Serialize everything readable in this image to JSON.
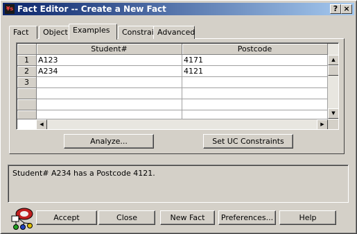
{
  "window": {
    "title": "Fact Editor -- Create a New Fact",
    "icon_label": "¥s",
    "help_label": "?",
    "close_label": "×"
  },
  "tabs": [
    {
      "label": "Fact",
      "active": false
    },
    {
      "label": "Object",
      "active": false
    },
    {
      "label": "Examples",
      "active": true
    },
    {
      "label": "Constraints",
      "active": false
    },
    {
      "label": "Advanced",
      "active": false
    }
  ],
  "grid": {
    "columns": [
      "Student#",
      "Postcode"
    ],
    "rows": [
      {
        "num": "1",
        "cells": [
          "A123",
          "4171"
        ]
      },
      {
        "num": "2",
        "cells": [
          "A234",
          "4121"
        ]
      },
      {
        "num": "3",
        "cells": [
          "",
          ""
        ]
      },
      {
        "num": "",
        "cells": [
          "",
          ""
        ]
      },
      {
        "num": "",
        "cells": [
          "",
          ""
        ]
      }
    ],
    "scroll_icons": {
      "up": "triangle-up",
      "down": "triangle-down",
      "left": "triangle-left",
      "right": "triangle-right"
    }
  },
  "actions": {
    "analyze": "Analyze...",
    "set_uc": "Set UC Constraints"
  },
  "status_text": "Student# A234 has a Postcode 4121.",
  "footer": {
    "accept": "Accept",
    "close": "Close",
    "new_fact": "New Fact",
    "preferences": "Preferences...",
    "help": "Help"
  }
}
